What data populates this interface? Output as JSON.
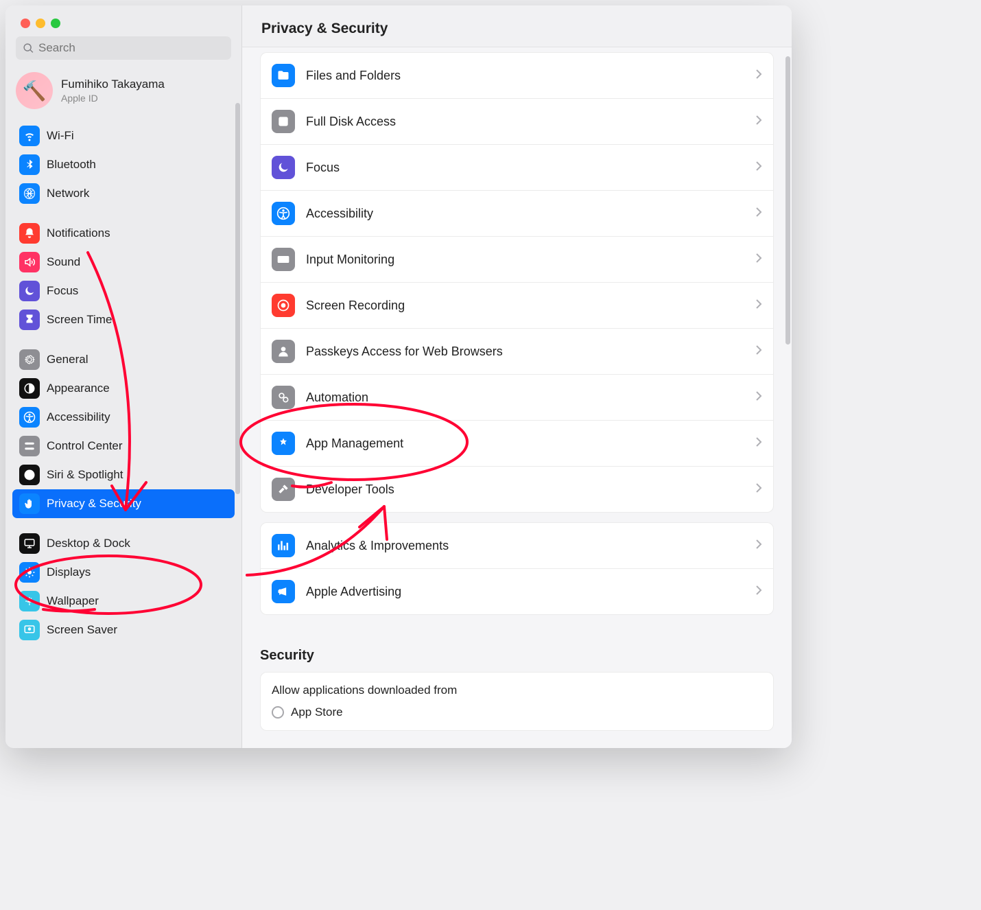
{
  "search": {
    "placeholder": "Search"
  },
  "profile": {
    "name": "Fumihiko Takayama",
    "subtitle": "Apple ID",
    "avatar_emoji": "🔨"
  },
  "sidebar": {
    "groups": [
      {
        "items": [
          {
            "id": "wifi",
            "label": "Wi-Fi",
            "icon": "wifi-icon",
            "color": "#0b84ff"
          },
          {
            "id": "bluetooth",
            "label": "Bluetooth",
            "icon": "bluetooth-icon",
            "color": "#0b84ff"
          },
          {
            "id": "network",
            "label": "Network",
            "icon": "network-icon",
            "color": "#0b84ff"
          }
        ]
      },
      {
        "items": [
          {
            "id": "notifications",
            "label": "Notifications",
            "icon": "bell-icon",
            "color": "#ff3b30"
          },
          {
            "id": "sound",
            "label": "Sound",
            "icon": "sound-icon",
            "color": "#ff3264"
          },
          {
            "id": "focus",
            "label": "Focus",
            "icon": "moon-icon",
            "color": "#6152d8"
          },
          {
            "id": "screentime",
            "label": "Screen Time",
            "icon": "hourglass-icon",
            "color": "#6152d8"
          }
        ]
      },
      {
        "items": [
          {
            "id": "general",
            "label": "General",
            "icon": "gear-icon",
            "color": "#8e8e93"
          },
          {
            "id": "appearance",
            "label": "Appearance",
            "icon": "appearance-icon",
            "color": "#111"
          },
          {
            "id": "accessibility",
            "label": "Accessibility",
            "icon": "accessibility-icon",
            "color": "#0b84ff"
          },
          {
            "id": "controlcenter",
            "label": "Control Center",
            "icon": "controlcenter-icon",
            "color": "#8e8e93"
          },
          {
            "id": "siri",
            "label": "Siri & Spotlight",
            "icon": "siri-icon",
            "color": "#111"
          },
          {
            "id": "privacy",
            "label": "Privacy & Security",
            "icon": "hand-icon",
            "color": "#0b84ff",
            "selected": true
          }
        ]
      },
      {
        "items": [
          {
            "id": "desktop",
            "label": "Desktop & Dock",
            "icon": "desktop-icon",
            "color": "#111"
          },
          {
            "id": "displays",
            "label": "Displays",
            "icon": "displays-icon",
            "color": "#0b84ff"
          },
          {
            "id": "wallpaper",
            "label": "Wallpaper",
            "icon": "wallpaper-icon",
            "color": "#37c5e8"
          },
          {
            "id": "screensaver",
            "label": "Screen Saver",
            "icon": "screensaver-icon",
            "color": "#37c5e8"
          }
        ]
      }
    ]
  },
  "main": {
    "title": "Privacy & Security",
    "groups": [
      {
        "rows": [
          {
            "id": "files",
            "label": "Files and Folders",
            "icon": "folder-icon",
            "color": "#0b84ff"
          },
          {
            "id": "fulldisk",
            "label": "Full Disk Access",
            "icon": "disk-icon",
            "color": "#8e8e93"
          },
          {
            "id": "focus",
            "label": "Focus",
            "icon": "moon-icon",
            "color": "#6152d8"
          },
          {
            "id": "accessibility",
            "label": "Accessibility",
            "icon": "accessibility-icon",
            "color": "#0b84ff"
          },
          {
            "id": "inputmon",
            "label": "Input Monitoring",
            "icon": "keyboard-icon",
            "color": "#8e8e93"
          },
          {
            "id": "screenrec",
            "label": "Screen Recording",
            "icon": "record-icon",
            "color": "#ff3b30"
          },
          {
            "id": "passkeys",
            "label": "Passkeys Access for Web Browsers",
            "icon": "person-icon",
            "color": "#8e8e93"
          },
          {
            "id": "automation",
            "label": "Automation",
            "icon": "gear2-icon",
            "color": "#8e8e93"
          },
          {
            "id": "appmanage",
            "label": "App Management",
            "icon": "appstore-icon",
            "color": "#0b84ff"
          },
          {
            "id": "devtools",
            "label": "Developer Tools",
            "icon": "hammer-icon",
            "color": "#8e8e93"
          }
        ]
      },
      {
        "rows": [
          {
            "id": "analytics",
            "label": "Analytics & Improvements",
            "icon": "chart-icon",
            "color": "#0b84ff"
          },
          {
            "id": "ads",
            "label": "Apple Advertising",
            "icon": "megaphone-icon",
            "color": "#0b84ff"
          }
        ]
      }
    ],
    "security_section_title": "Security",
    "security_prompt": "Allow applications downloaded from",
    "security_option1": "App Store"
  },
  "annotation": {
    "color": "#ff0033"
  }
}
